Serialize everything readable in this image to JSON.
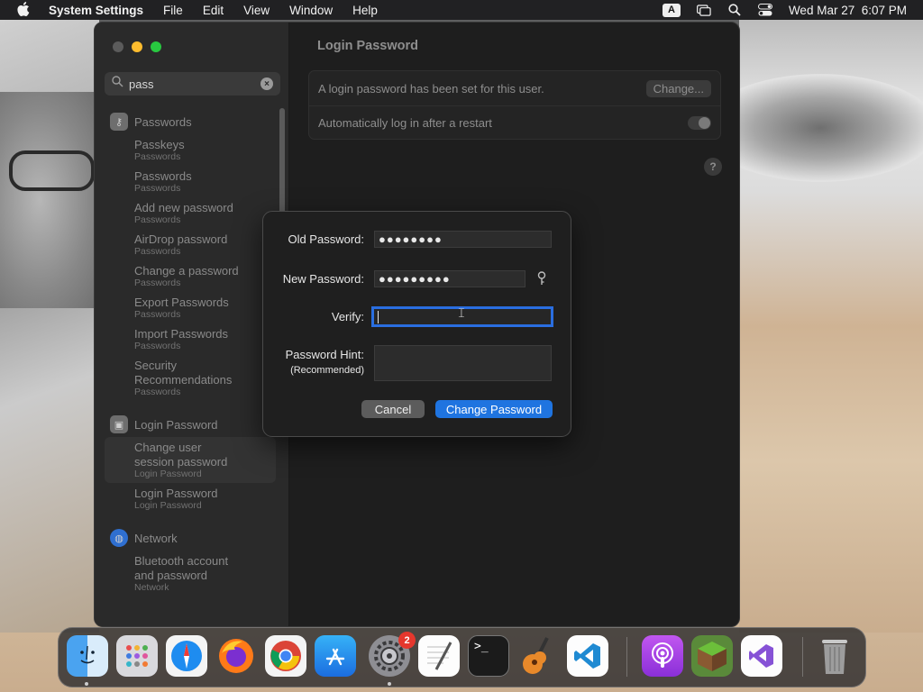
{
  "menubar": {
    "app_name": "System Settings",
    "items": [
      "File",
      "Edit",
      "View",
      "Window",
      "Help"
    ],
    "input_source": "A",
    "clock": "Wed Mar 27  6:07 PM"
  },
  "sidebar": {
    "search_value": "pass",
    "sections": [
      {
        "title": "Passwords",
        "items": [
          {
            "label": "Passkeys",
            "sub": "Passwords"
          },
          {
            "label": "Passwords",
            "sub": "Passwords"
          },
          {
            "label": "Add new password",
            "sub": "Passwords"
          },
          {
            "label": "AirDrop password",
            "sub": "Passwords"
          },
          {
            "label": "Change a password",
            "sub": "Passwords"
          },
          {
            "label": "Export Passwords",
            "sub": "Passwords"
          },
          {
            "label": "Import Passwords",
            "sub": "Passwords"
          },
          {
            "label": "Security Recommendations",
            "sub": "Passwords"
          }
        ]
      },
      {
        "title": "Login Password",
        "items": [
          {
            "label": "Change user session password",
            "sub": "Login Password"
          },
          {
            "label": "Login Password",
            "sub": "Login Password"
          }
        ]
      },
      {
        "title": "Network",
        "items": [
          {
            "label": "Bluetooth account and password",
            "sub": "Network"
          }
        ]
      }
    ]
  },
  "main": {
    "title": "Login Password",
    "row1_text": "A login password has been set for this user.",
    "change_label": "Change...",
    "row2_text": "Automatically log in after a restart",
    "auto_login": false,
    "help_label": "?"
  },
  "dialog": {
    "old_label": "Old Password:",
    "old_value": "●●●●●●●●",
    "new_label": "New Password:",
    "new_value": "●●●●●●●●●",
    "verify_label": "Verify:",
    "verify_value": "",
    "hint_label": "Password Hint:",
    "hint_sub": "(Recommended)",
    "hint_value": "",
    "cancel_label": "Cancel",
    "submit_label": "Change Password"
  },
  "dock": {
    "settings_badge": "2",
    "terminal_prompt": ">_",
    "apps": [
      "finder",
      "launchpad",
      "safari",
      "firefox",
      "chrome",
      "app-store",
      "system-settings",
      "textedit",
      "terminal",
      "garageband",
      "vscode",
      "podcasts",
      "minecraft",
      "visual-studio",
      "trash"
    ]
  },
  "colors": {
    "accent": "#1f74e0",
    "window_bg": "#1e1e1e",
    "sidebar_bg": "#2a2a2a"
  }
}
